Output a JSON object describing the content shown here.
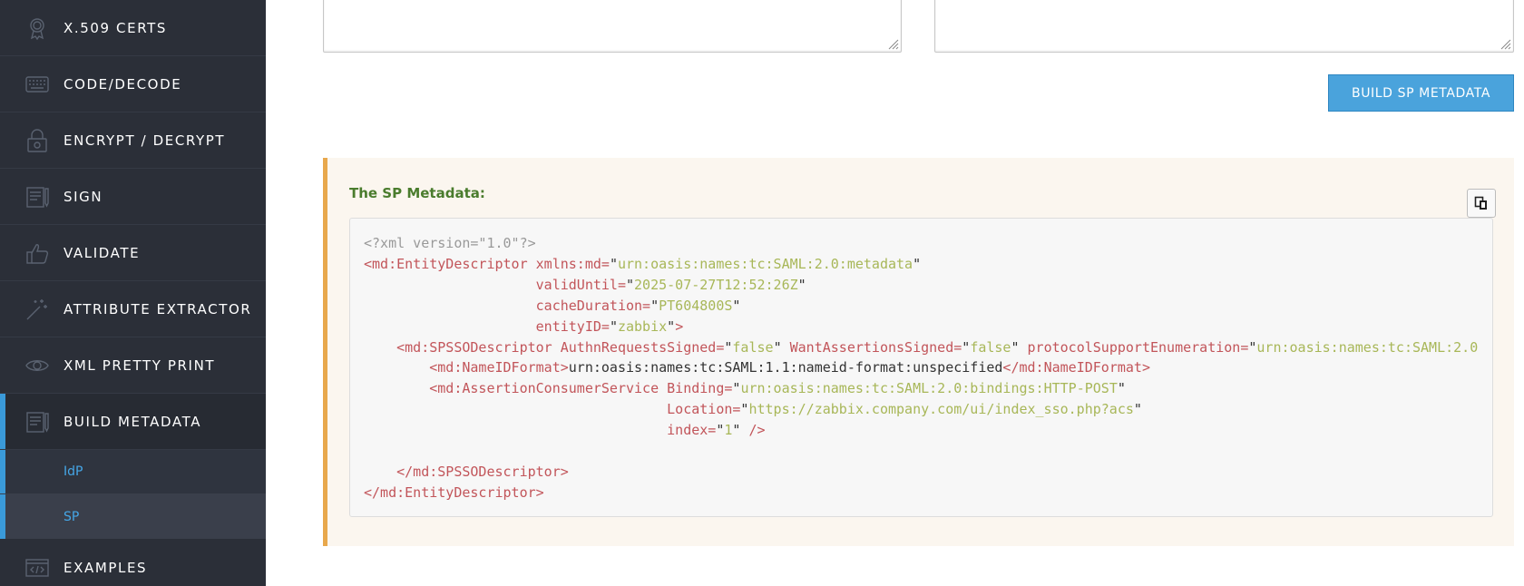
{
  "sidebar": {
    "items": [
      {
        "label": "X.509 CERTS",
        "icon": "certificate-icon"
      },
      {
        "label": "CODE/DECODE",
        "icon": "keyboard-icon"
      },
      {
        "label": "ENCRYPT / DECRYPT",
        "icon": "lock-icon"
      },
      {
        "label": "SIGN",
        "icon": "sign-document-icon"
      },
      {
        "label": "VALIDATE",
        "icon": "thumbs-up-icon"
      },
      {
        "label": "ATTRIBUTE EXTRACTOR",
        "icon": "magic-wand-icon"
      },
      {
        "label": "XML PRETTY PRINT",
        "icon": "eye-icon"
      },
      {
        "label": "BUILD METADATA",
        "icon": "build-document-icon"
      },
      {
        "label": "EXAMPLES",
        "icon": "code-icon"
      }
    ],
    "sub_items": [
      {
        "label": "IdP"
      },
      {
        "label": "SP"
      }
    ]
  },
  "main": {
    "build_button_label": "BUILD SP METADATA",
    "result_title": "The SP Metadata:",
    "copy_icon": "copy-icon",
    "code": {
      "xml_decl": "<?xml version=\"1.0\"?>",
      "entity_open": "<md:EntityDescriptor",
      "xmlns_attr": "xmlns:md=",
      "xmlns_val": "urn:oasis:names:tc:SAML:2.0:metadata",
      "valid_until_attr": "validUntil=",
      "valid_until_val": "2025-07-27T12:52:26Z",
      "cache_attr": "cacheDuration=",
      "cache_val": "PT604800S",
      "entity_id_attr": "entityID=",
      "entity_id_val": "zabbix",
      "spsso_open": "<md:SPSSODescriptor",
      "authn_attr": "AuthnRequestsSigned=",
      "authn_val": "false",
      "want_attr": "WantAssertionsSigned=",
      "want_val": "false",
      "protocol_attr": "protocolSupportEnumeration=",
      "protocol_val": "urn:oasis:names:tc:SAML:2.0",
      "nameid_open": "<md:NameIDFormat>",
      "nameid_text": "urn:oasis:names:tc:SAML:1.1:nameid-format:unspecified",
      "nameid_close": "</md:NameIDFormat>",
      "acs_open": "<md:AssertionConsumerService",
      "binding_attr": "Binding=",
      "binding_val": "urn:oasis:names:tc:SAML:2.0:bindings:HTTP-POST",
      "location_attr": "Location=",
      "location_val": "https://zabbix.company.com/ui/index_sso.php?acs",
      "index_attr": "index=",
      "index_val": "1",
      "self_close": " />",
      "spsso_close": "</md:SPSSODescriptor>",
      "entity_close": "</md:EntityDescriptor>"
    }
  },
  "colors": {
    "sidebar_bg": "#2b2f38",
    "accent": "#3a9ad9",
    "button": "#4aa3dc",
    "panel_border": "#e8a84c",
    "title_green": "#4a7c2d"
  }
}
